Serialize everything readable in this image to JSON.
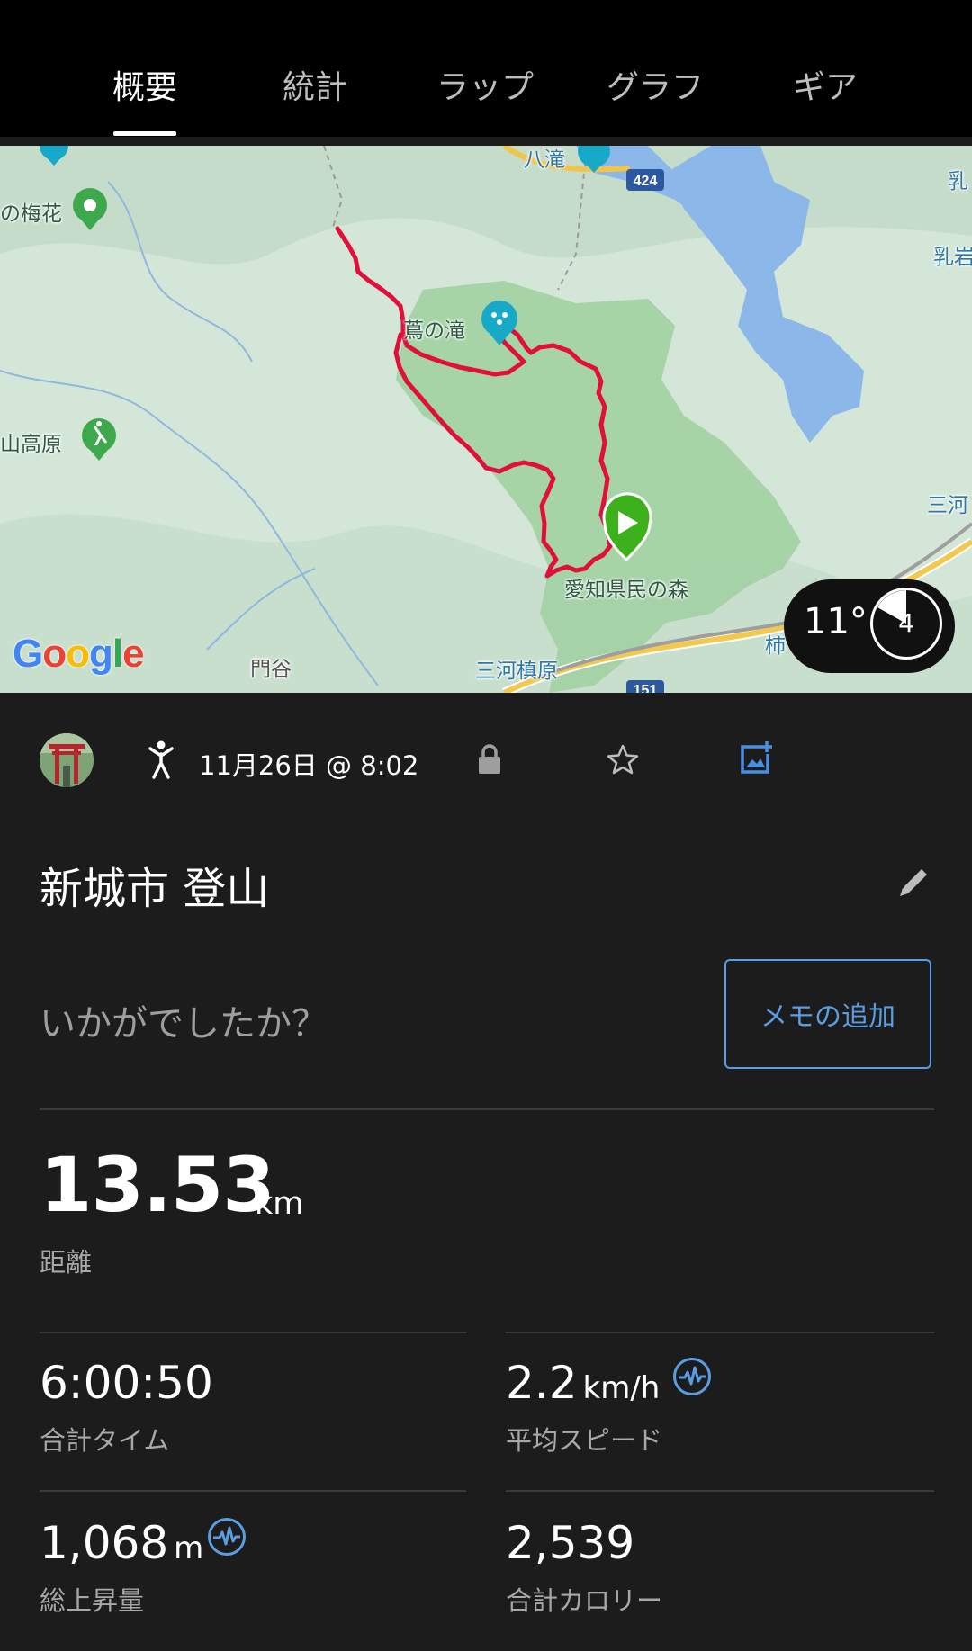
{
  "tabs": [
    {
      "label": "概要",
      "active": true
    },
    {
      "label": "統計",
      "active": false
    },
    {
      "label": "ラップ",
      "active": false
    },
    {
      "label": "グラフ",
      "active": false
    },
    {
      "label": "ギア",
      "active": false
    }
  ],
  "map": {
    "labels": {
      "ume": "の梅花",
      "hachitaki": "八滝",
      "tsuta_falls": "蔦の滝",
      "kogen": "山高原",
      "kenmin_forest": "愛知県民の森",
      "kadoya": "門谷",
      "station": "三河槙原",
      "nyuiwa1": "乳",
      "nyuiwa2": "乳岩",
      "mikawa": "三河",
      "kaki": "柿",
      "route_424": "424",
      "route_151": "151"
    },
    "logo_text": "Google",
    "route_color": "#e0103a",
    "start_marker_color": "#3db11c"
  },
  "weather": {
    "temperature": "11°",
    "wind": "4"
  },
  "activity": {
    "icon": "hiking-icon",
    "date": "11月26日 @ 8:02",
    "title": "新城市 登山",
    "prompt": "いかがでしたか？",
    "memo_button": "メモの追加"
  },
  "stats": {
    "distance": {
      "value": "13.53",
      "unit": "km",
      "label": "距離"
    },
    "total_time": {
      "value": "6:00:50",
      "label": "合計タイム"
    },
    "avg_speed": {
      "value": "2.2",
      "unit": "km/h",
      "label": "平均スピード"
    },
    "ascent": {
      "value": "1,068",
      "unit": "m",
      "label": "総上昇量"
    },
    "calories": {
      "value": "2,539",
      "label": "合計カロリー"
    }
  },
  "colors": {
    "accent": "#5a9de0",
    "background": "#1c1c1c",
    "tab_bar": "#000000"
  }
}
